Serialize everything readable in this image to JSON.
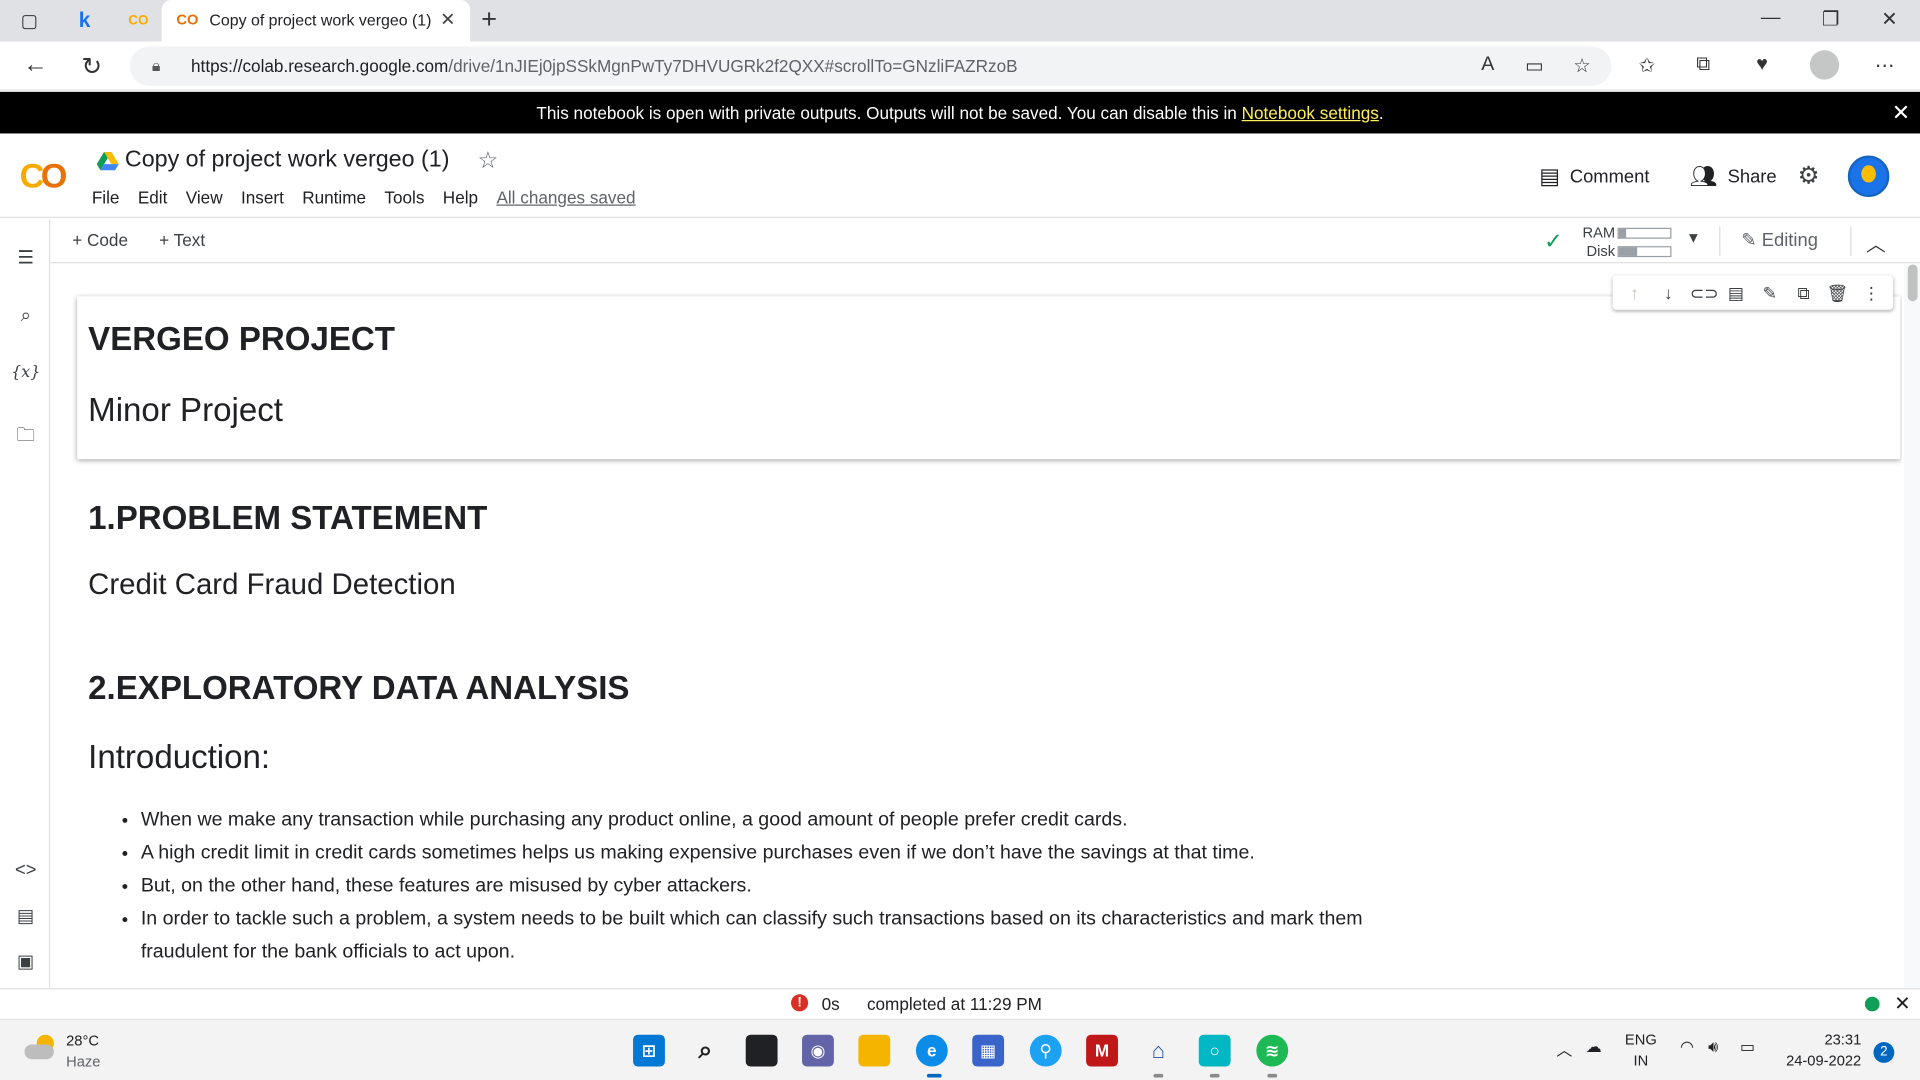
{
  "browser": {
    "tab_title": "Copy of project work vergeo (1)",
    "tab_favicon": "CO",
    "other_tab_k": "k",
    "url_host": "https://colab.research.google.com",
    "url_path": "/drive/1nJIEj0jpSSkMgnPwTy7DHVUGRk2f2QXX#scrollTo=GNzliFAZRzoB"
  },
  "banner": {
    "text": "This notebook is open with private outputs. Outputs will not be saved. You can disable this in ",
    "link": "Notebook settings",
    "suffix": "."
  },
  "colab": {
    "logo": "CO",
    "notebook_title": "Copy of project work vergeo (1)",
    "menu": [
      "File",
      "Edit",
      "View",
      "Insert",
      "Runtime",
      "Tools",
      "Help"
    ],
    "save_status": "All changes saved",
    "comment_label": "Comment",
    "share_label": "Share"
  },
  "toolbar": {
    "add_code": "+ Code",
    "add_text": "+ Text",
    "ram_label": "RAM",
    "disk_label": "Disk",
    "ram_usage": 0.15,
    "disk_usage": 0.35,
    "editing_label": "Editing"
  },
  "notebook": {
    "cell1_heading": "VERGEO PROJECT",
    "cell1_sub": "Minor Project",
    "section1_heading": "1.PROBLEM STATEMENT",
    "section1_text": "Credit Card Fraud Detection",
    "section2_heading": "2.EXPLORATORY DATA ANALYSIS",
    "intro_heading": "Introduction:",
    "bullets": [
      "When we make any transaction while purchasing any product online, a good amount of people prefer credit cards.",
      "A high credit limit in credit cards sometimes helps us making expensive purchases even if we don’t have the savings at that time.",
      "But, on the other hand, these features are misused by cyber attackers.",
      "In order to tackle such a problem, a system needs to be built which can classify such transactions based on its characteristics and mark them fraudulent for the bank officials to act upon."
    ]
  },
  "statusbar": {
    "error_icon": "!",
    "duration": "0s",
    "completed": "completed at 11:29 PM"
  },
  "taskbar": {
    "temp": "28°C",
    "weather": "Haze",
    "lang1": "ENG",
    "lang2": "IN",
    "time": "23:31",
    "date": "24-09-2022",
    "notifications": "2"
  },
  "colors": {
    "colab_orange": "#e8710a",
    "colab_yellow": "#f9ab00",
    "banner_link": "#ffee58",
    "ok_green": "#0f9d58",
    "error_red": "#d93025"
  }
}
